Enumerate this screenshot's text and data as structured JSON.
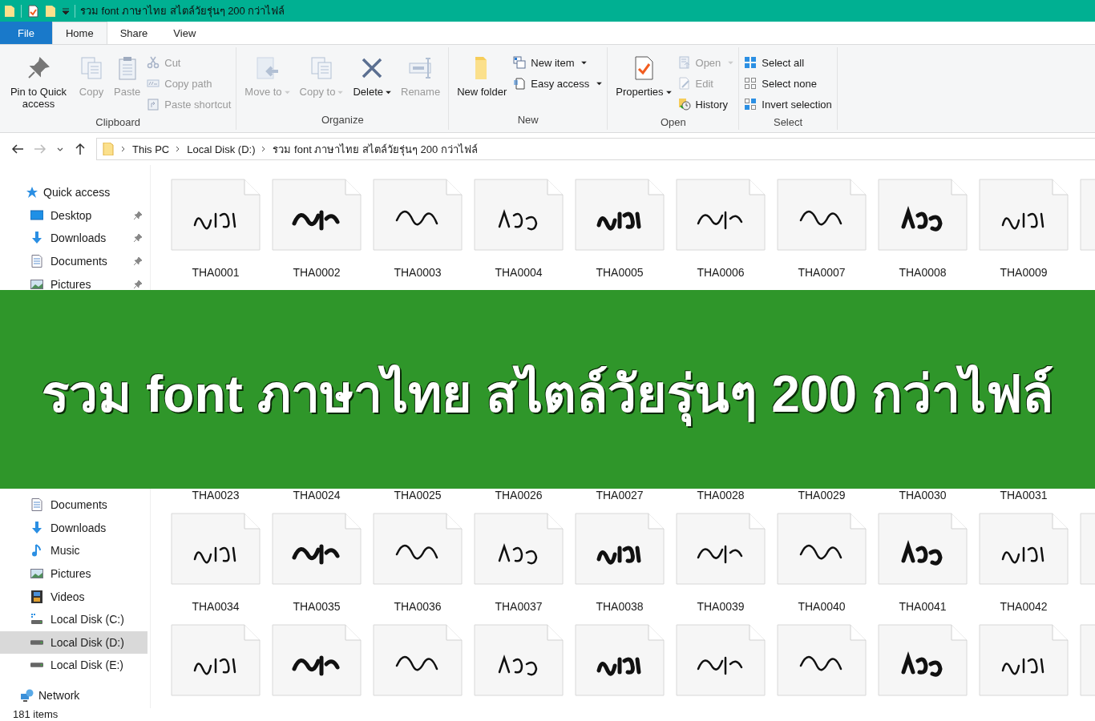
{
  "window": {
    "title": "รวม font ภาษาไทย สไตล์วัยรุ่นๆ 200 กว่าไฟล์"
  },
  "tabs": [
    {
      "label": "File",
      "kind": "file",
      "selected": false
    },
    {
      "label": "Home",
      "kind": "tab",
      "selected": true
    },
    {
      "label": "Share",
      "kind": "tab",
      "selected": false
    },
    {
      "label": "View",
      "kind": "tab",
      "selected": false
    }
  ],
  "ribbon": {
    "groups": [
      {
        "label": "Clipboard",
        "items": [
          {
            "label": "Pin to Quick access",
            "kind": "pin",
            "disabled": false,
            "dropdown": false
          },
          {
            "label": "Copy",
            "kind": "copy",
            "disabled": true,
            "dropdown": false
          },
          {
            "label": "Paste",
            "kind": "paste",
            "disabled": true,
            "dropdown": false
          },
          {
            "label": "Cut",
            "kind": "cut",
            "disabled": true,
            "dropdown": false
          },
          {
            "label": "Copy path",
            "kind": "copy-path",
            "disabled": true,
            "dropdown": false
          },
          {
            "label": "Paste shortcut",
            "kind": "paste-shortcut",
            "disabled": true,
            "dropdown": false
          }
        ]
      },
      {
        "label": "Organize",
        "items": [
          {
            "label": "Move to",
            "kind": "move",
            "disabled": true,
            "dropdown": true
          },
          {
            "label": "Copy to",
            "kind": "copy-to",
            "disabled": true,
            "dropdown": true
          },
          {
            "label": "Delete",
            "kind": "delete",
            "disabled": false,
            "dropdown": true
          },
          {
            "label": "Rename",
            "kind": "rename",
            "disabled": true,
            "dropdown": false
          }
        ]
      },
      {
        "label": "New",
        "items": [
          {
            "label": "New folder",
            "kind": "folder",
            "disabled": false,
            "dropdown": false
          },
          {
            "label": "New item",
            "kind": "new-item",
            "disabled": false,
            "dropdown": true
          },
          {
            "label": "Easy access",
            "kind": "easy-access",
            "disabled": false,
            "dropdown": true
          }
        ]
      },
      {
        "label": "Open",
        "items": [
          {
            "label": "Properties",
            "kind": "properties",
            "disabled": false,
            "dropdown": true
          },
          {
            "label": "Open",
            "kind": "open",
            "disabled": true,
            "dropdown": true
          },
          {
            "label": "Edit",
            "kind": "edit",
            "disabled": true,
            "dropdown": false
          },
          {
            "label": "History",
            "kind": "history",
            "disabled": false,
            "dropdown": false
          }
        ]
      },
      {
        "label": "Select",
        "items": [
          {
            "label": "Select all",
            "kind": "select-all",
            "disabled": false,
            "dropdown": false
          },
          {
            "label": "Select none",
            "kind": "select-none",
            "disabled": false,
            "dropdown": false
          },
          {
            "label": "Invert selection",
            "kind": "invert",
            "disabled": false,
            "dropdown": false
          }
        ]
      }
    ]
  },
  "address": {
    "crumbs": [
      "This PC",
      "Local Disk (D:)",
      "รวม font ภาษาไทย สไตล์วัยรุ่นๆ 200 กว่าไฟล์"
    ]
  },
  "nav": [
    {
      "label": "Quick access",
      "kind": "quick-access",
      "children": [
        {
          "label": "Desktop",
          "kind": "desktop",
          "pinned": true,
          "selected": false
        },
        {
          "label": "Downloads",
          "kind": "downloads",
          "pinned": true,
          "selected": false
        },
        {
          "label": "Documents",
          "kind": "documents",
          "pinned": true,
          "selected": false
        },
        {
          "label": "Pictures",
          "kind": "pictures",
          "pinned": true,
          "selected": false
        }
      ]
    },
    {
      "children": [
        {
          "label": "Documents",
          "kind": "documents",
          "pinned": false,
          "selected": false
        },
        {
          "label": "Downloads",
          "kind": "downloads",
          "pinned": false,
          "selected": false
        },
        {
          "label": "Music",
          "kind": "music",
          "pinned": false,
          "selected": false
        },
        {
          "label": "Pictures",
          "kind": "pictures",
          "pinned": false,
          "selected": false
        },
        {
          "label": "Videos",
          "kind": "videos",
          "pinned": false,
          "selected": false
        },
        {
          "label": "Local Disk (C:)",
          "kind": "system-drive",
          "pinned": false,
          "selected": false
        },
        {
          "label": "Local Disk (D:)",
          "kind": "drive",
          "pinned": false,
          "selected": true
        },
        {
          "label": "Local Disk (E:)",
          "kind": "drive",
          "pinned": false,
          "selected": false
        }
      ]
    },
    {
      "label": "Network",
      "kind": "network"
    }
  ],
  "files": {
    "rows": [
      {
        "kind": "tiles",
        "items": [
          {
            "kind": "font-file",
            "name": "THA0001"
          },
          {
            "kind": "font-file",
            "name": "THA0002"
          },
          {
            "kind": "font-file",
            "name": "THA0003"
          },
          {
            "kind": "font-file",
            "name": "THA0004"
          },
          {
            "kind": "font-file",
            "name": "THA0005"
          },
          {
            "kind": "font-file",
            "name": "THA0006"
          },
          {
            "kind": "font-file",
            "name": "THA0007"
          },
          {
            "kind": "font-file",
            "name": "THA0008"
          },
          {
            "kind": "font-file",
            "name": "THA0009"
          },
          {
            "kind": "font-file"
          }
        ]
      },
      {
        "kind": "names-only",
        "items": [
          {
            "kind": "font-file",
            "name": "THA0023"
          },
          {
            "kind": "font-file",
            "name": "THA0024"
          },
          {
            "kind": "font-file",
            "name": "THA0025"
          },
          {
            "kind": "font-file",
            "name": "THA0026"
          },
          {
            "kind": "font-file",
            "name": "THA0027"
          },
          {
            "kind": "font-file",
            "name": "THA0028"
          },
          {
            "kind": "font-file",
            "name": "THA0029"
          },
          {
            "kind": "font-file",
            "name": "THA0030"
          },
          {
            "kind": "font-file",
            "name": "THA0031"
          }
        ]
      },
      {
        "kind": "tiles",
        "items": [
          {
            "kind": "font-file",
            "name": "THA0034"
          },
          {
            "kind": "font-file",
            "name": "THA0035"
          },
          {
            "kind": "font-file",
            "name": "THA0036"
          },
          {
            "kind": "font-file",
            "name": "THA0037"
          },
          {
            "kind": "font-file",
            "name": "THA0038"
          },
          {
            "kind": "font-file",
            "name": "THA0039"
          },
          {
            "kind": "font-file",
            "name": "THA0040"
          },
          {
            "kind": "font-file",
            "name": "THA0041"
          },
          {
            "kind": "font-file",
            "name": "THA0042"
          },
          {
            "kind": "font-file"
          }
        ]
      },
      {
        "kind": "tiles",
        "items": [
          {
            "kind": "font-file"
          },
          {
            "kind": "font-file"
          },
          {
            "kind": "font-file"
          },
          {
            "kind": "font-file"
          },
          {
            "kind": "font-file"
          },
          {
            "kind": "font-file"
          },
          {
            "kind": "font-file"
          },
          {
            "kind": "font-file"
          },
          {
            "kind": "font-file"
          },
          {
            "kind": "font-file"
          }
        ]
      }
    ]
  },
  "banner": {
    "text": "รวม font ภาษาไทย สไตล์วัยรุ่นๆ 200 กว่าไฟล์"
  },
  "status_bar": {
    "text": "181 items"
  }
}
